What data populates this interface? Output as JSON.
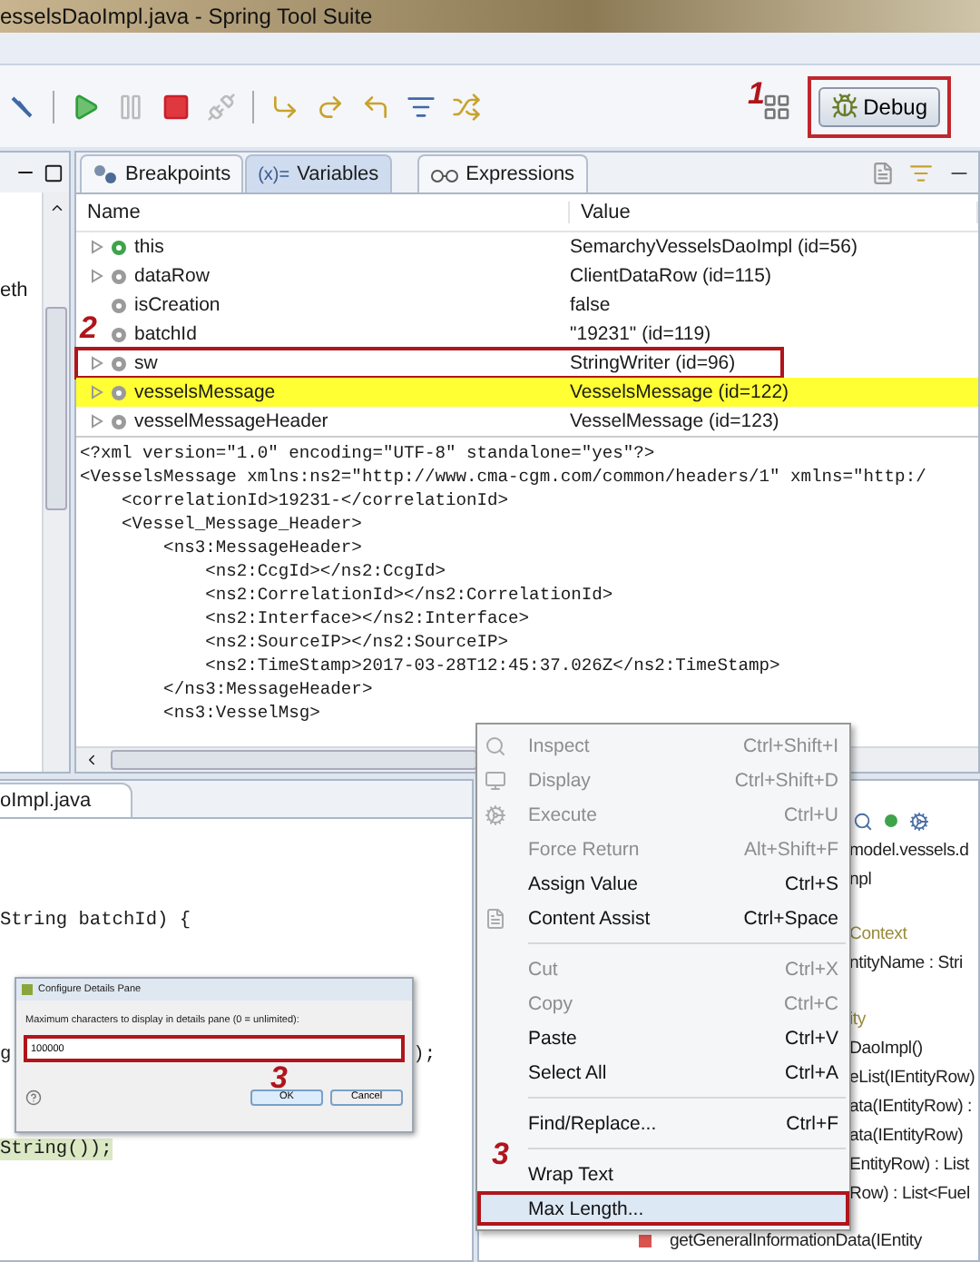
{
  "window": {
    "title": "esselsDaoImpl.java - Spring Tool Suite"
  },
  "toolbar": {
    "perspective": {
      "label": "Debug",
      "selected": true,
      "boxed": true
    },
    "annotation": "1"
  },
  "left_panel": {
    "text": "eth"
  },
  "debug_view": {
    "tabs": [
      {
        "label": "Breakpoints",
        "selected": false,
        "kind": "breakpoints"
      },
      {
        "label": "Variables",
        "selected": true,
        "kind": "variables",
        "icon_text": "(x)="
      },
      {
        "label": "Expressions",
        "selected": false,
        "kind": "expressions"
      }
    ],
    "columns": [
      "Name",
      "Value"
    ],
    "rows": [
      {
        "name": "this",
        "value": "SemarchyVesselsDaoImpl  (id=56)",
        "expandable": true,
        "kind": "this",
        "highlighted": false,
        "boxed": false
      },
      {
        "name": "dataRow",
        "value": "ClientDataRow  (id=115)",
        "expandable": true,
        "kind": "local",
        "highlighted": false,
        "boxed": false
      },
      {
        "name": "isCreation",
        "value": "false",
        "expandable": false,
        "kind": "local",
        "highlighted": false,
        "boxed": false
      },
      {
        "name": "batchId",
        "value": "\"19231\" (id=119)",
        "expandable": false,
        "kind": "local",
        "highlighted": false,
        "boxed": false
      },
      {
        "name": "sw",
        "value": "StringWriter  (id=96)",
        "expandable": true,
        "kind": "local",
        "highlighted": false,
        "boxed": true
      },
      {
        "name": "vesselsMessage",
        "value": "VesselsMessage  (id=122)",
        "expandable": true,
        "kind": "local",
        "highlighted": true,
        "boxed": false
      },
      {
        "name": "vesselMessageHeader",
        "value": "VesselMessage  (id=123)",
        "expandable": true,
        "kind": "local",
        "highlighted": false,
        "boxed": false
      }
    ],
    "annotation": "2",
    "details": [
      "<?xml version=\"1.0\" encoding=\"UTF-8\" standalone=\"yes\"?>",
      "<VesselsMessage xmlns:ns2=\"http://www.cma-cgm.com/common/headers/1\" xmlns=\"http:/",
      "    <correlationId>19231-</correlationId>",
      "    <Vessel_Message_Header>",
      "        <ns3:MessageHeader>",
      "            <ns2:CcgId></ns2:CcgId>",
      "            <ns2:CorrelationId></ns2:CorrelationId>",
      "            <ns2:Interface></ns2:Interface>",
      "            <ns2:SourceIP></ns2:SourceIP>",
      "            <ns2:TimeStamp>2017-03-28T12:45:37.026Z</ns2:TimeStamp>",
      "        </ns3:MessageHeader>",
      "        <ns3:VesselMsg>"
    ]
  },
  "editor": {
    "tab": "oImpl.java",
    "lines": [
      {
        "kind": "plain",
        "text": "String batchId) {"
      },
      {
        "kind": "split",
        "left": "g",
        "right": ");"
      },
      {
        "kind": "highlight",
        "text": "String());"
      }
    ]
  },
  "dialog": {
    "title": "Configure Details Pane",
    "label": "Maximum characters to display in details pane (0 = unlimited):",
    "value": "100000",
    "buttons": [
      "OK",
      "Cancel"
    ],
    "annotation": "3"
  },
  "outline": {
    "rows": [
      {
        "text": "model.vessels.d",
        "kind": "plain"
      },
      {
        "text": "npl",
        "kind": "plain"
      },
      {
        "text": "Context",
        "kind": "muted"
      },
      {
        "text": "ntityName : Stri",
        "kind": "plain"
      },
      {
        "text": "ity",
        "kind": "muted"
      },
      {
        "text": "DaoImpl()",
        "kind": "plain"
      },
      {
        "text": "eList(IEntityRow)",
        "kind": "plain"
      },
      {
        "text": "ata(IEntityRow) :",
        "kind": "plain"
      },
      {
        "text": "ata(IEntityRow)",
        "kind": "plain"
      },
      {
        "text": "EntityRow) : List",
        "kind": "plain"
      },
      {
        "text": "Row) : List<Fuel",
        "kind": "plain"
      },
      {
        "text": "getGeneralInformationData(IEntity",
        "kind": "method"
      }
    ]
  },
  "context_menu": {
    "items": [
      {
        "label": "Inspect",
        "shortcut": "Ctrl+Shift+I",
        "disabled": true,
        "icon": true,
        "separator_before": false,
        "boxed": false
      },
      {
        "label": "Display",
        "shortcut": "Ctrl+Shift+D",
        "disabled": true,
        "icon": true,
        "separator_before": false,
        "boxed": false
      },
      {
        "label": "Execute",
        "shortcut": "Ctrl+U",
        "disabled": true,
        "icon": true,
        "separator_before": false,
        "boxed": false
      },
      {
        "label": "Force Return",
        "shortcut": "Alt+Shift+F",
        "disabled": true,
        "icon": false,
        "separator_before": false,
        "boxed": false
      },
      {
        "label": "Assign Value",
        "shortcut": "Ctrl+S",
        "disabled": false,
        "icon": false,
        "separator_before": false,
        "boxed": false
      },
      {
        "label": "Content Assist",
        "shortcut": "Ctrl+Space",
        "disabled": false,
        "icon": true,
        "separator_before": false,
        "boxed": false
      },
      {
        "label": "Cut",
        "shortcut": "Ctrl+X",
        "disabled": true,
        "icon": false,
        "separator_before": true,
        "boxed": false
      },
      {
        "label": "Copy",
        "shortcut": "Ctrl+C",
        "disabled": true,
        "icon": false,
        "separator_before": false,
        "boxed": false
      },
      {
        "label": "Paste",
        "shortcut": "Ctrl+V",
        "disabled": false,
        "icon": false,
        "separator_before": false,
        "boxed": false
      },
      {
        "label": "Select All",
        "shortcut": "Ctrl+A",
        "disabled": false,
        "icon": false,
        "separator_before": false,
        "boxed": false
      },
      {
        "label": "Find/Replace...",
        "shortcut": "Ctrl+F",
        "disabled": false,
        "icon": false,
        "separator_before": true,
        "boxed": false
      },
      {
        "label": "Wrap Text",
        "disabled": false,
        "icon": false,
        "separator_before": true,
        "boxed": false,
        "annotation": "3"
      },
      {
        "label": "Max Length...",
        "disabled": false,
        "icon": false,
        "separator_before": false,
        "boxed": true
      }
    ]
  }
}
